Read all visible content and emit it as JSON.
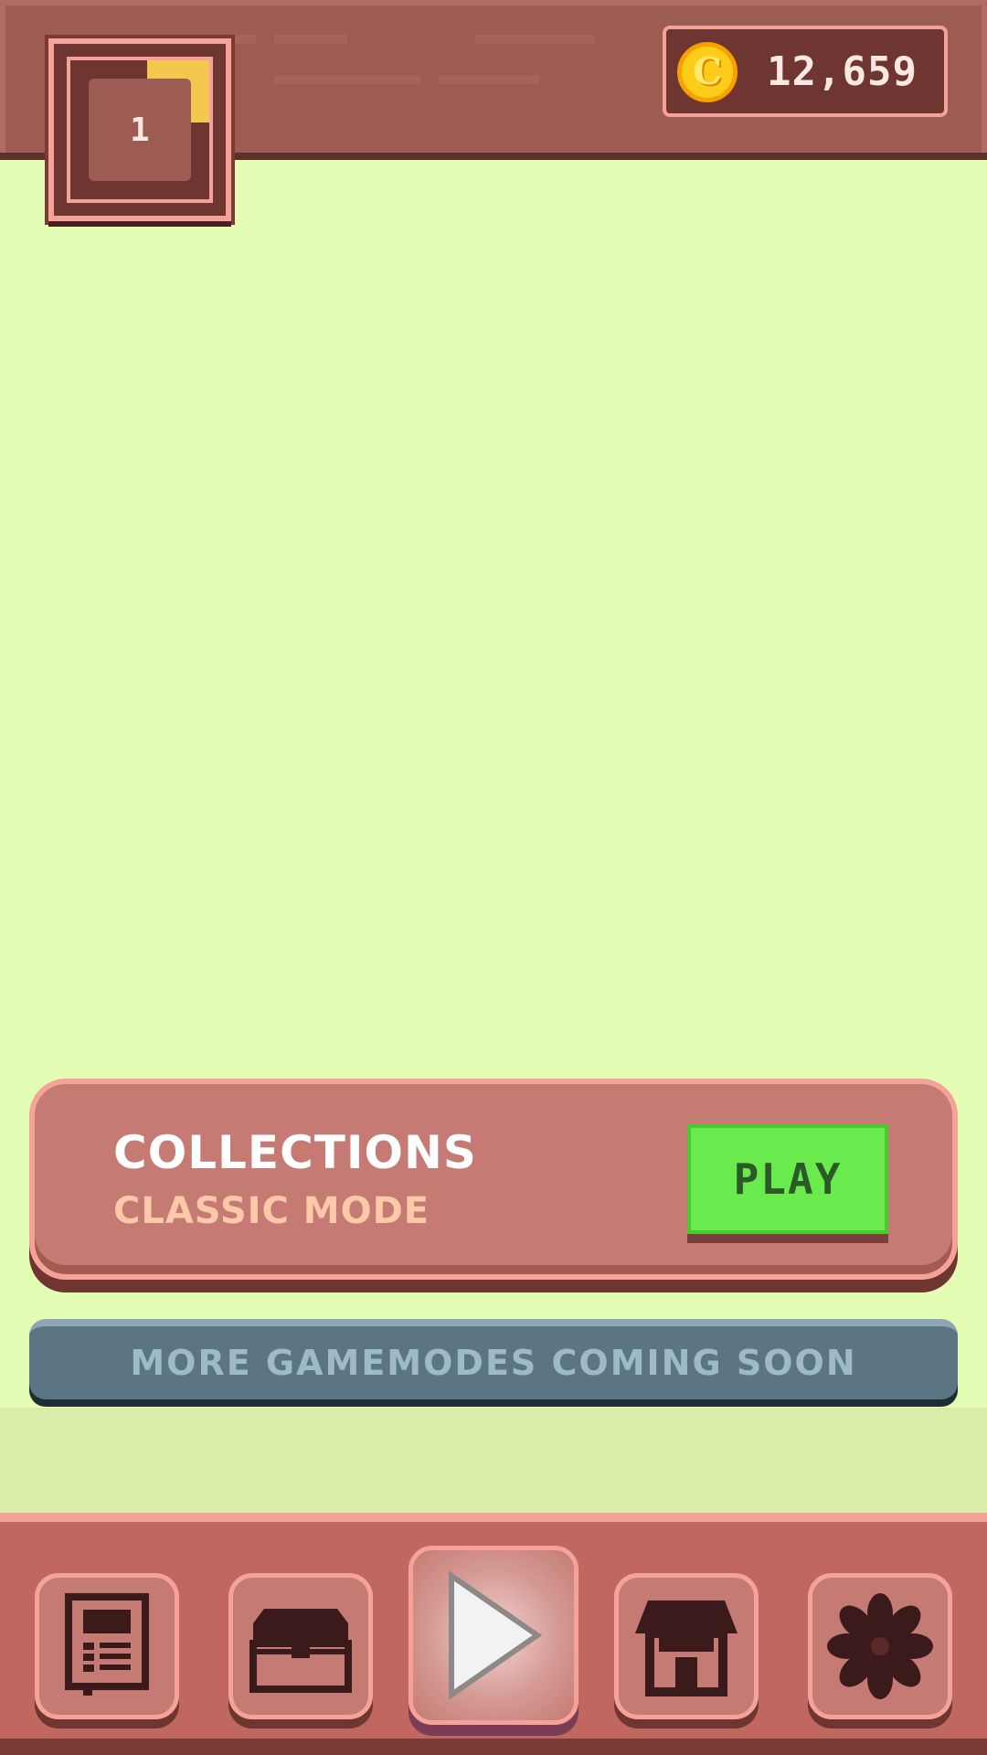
{
  "header": {
    "level": "1",
    "level_progress": 0.45,
    "coins": "12,659",
    "coin_symbol": "C"
  },
  "mode_card": {
    "title": "COLLECTIONS",
    "subtitle": "CLASSIC MODE",
    "play_label": "PLAY"
  },
  "banner": {
    "text": "MORE GAMEMODES COMING SOON"
  },
  "nav": {
    "items": [
      {
        "icon": "news-icon",
        "active": false
      },
      {
        "icon": "chest-icon",
        "active": false
      },
      {
        "icon": "play-icon",
        "active": true
      },
      {
        "icon": "shop-icon",
        "active": false
      },
      {
        "icon": "settings-gear-icon",
        "active": false
      }
    ]
  },
  "colors": {
    "background": "#e4fdb4",
    "panel": "#9c5b53",
    "card": "#c57b74",
    "play_green": "#6aea4c",
    "coin_gold": "#ffcc1a",
    "banner": "#5c7584"
  }
}
